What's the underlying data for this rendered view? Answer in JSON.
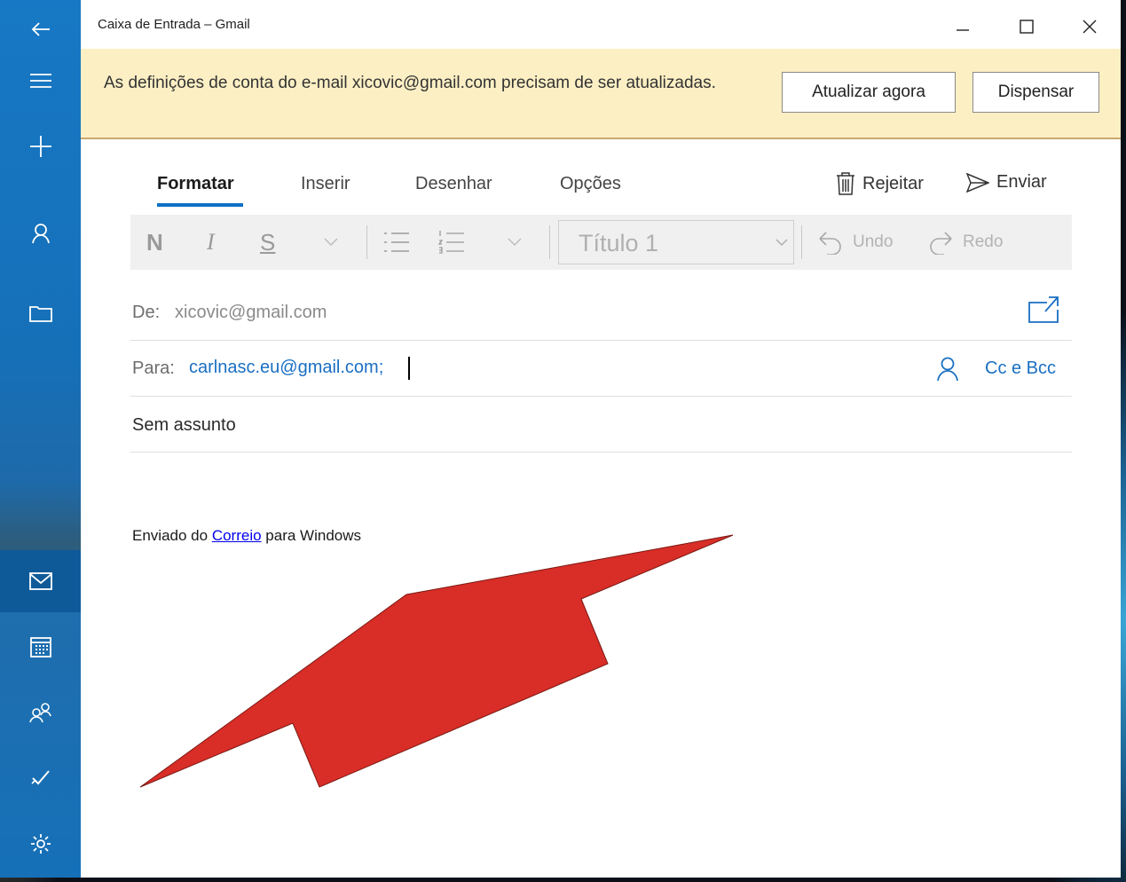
{
  "window": {
    "title": "Caixa de Entrada – Gmail"
  },
  "notification": {
    "message": "As definições de conta do e-mail xicovic@gmail.com precisam de ser atualizadas.",
    "update_button": "Atualizar agora",
    "dismiss_button": "Dispensar"
  },
  "compose": {
    "tabs": [
      {
        "label": "Formatar",
        "active": true
      },
      {
        "label": "Inserir",
        "active": false
      },
      {
        "label": "Desenhar",
        "active": false
      },
      {
        "label": "Opções",
        "active": false
      }
    ],
    "discard_label": "Rejeitar",
    "send_label": "Enviar",
    "toolbar": {
      "bold": "N",
      "italic": "I",
      "underline": "S",
      "style_value": "Título 1",
      "undo": "Undo",
      "redo": "Redo"
    },
    "from_label": "De:",
    "from_value": "xicovic@gmail.com",
    "to_label": "Para:",
    "to_value": "carlnasc.eu@gmail.com;",
    "cc_bcc_label": "Cc e Bcc",
    "subject_placeholder": "Sem assunto",
    "signature_prefix": "Enviado do",
    "signature_link": "Correio",
    "signature_suffix": "para Windows"
  },
  "rail_icons": [
    "back-arrow-icon",
    "hamburger-icon",
    "new-mail-icon",
    "account-icon",
    "folders-icon",
    "mail-icon",
    "calendar-icon",
    "people-icon",
    "todo-icon",
    "settings-icon"
  ],
  "colors": {
    "accent": "#0f70c6",
    "rail": "#1778c5",
    "notice_bg": "#fcefc4",
    "annotation_arrow": "#d92d27"
  }
}
